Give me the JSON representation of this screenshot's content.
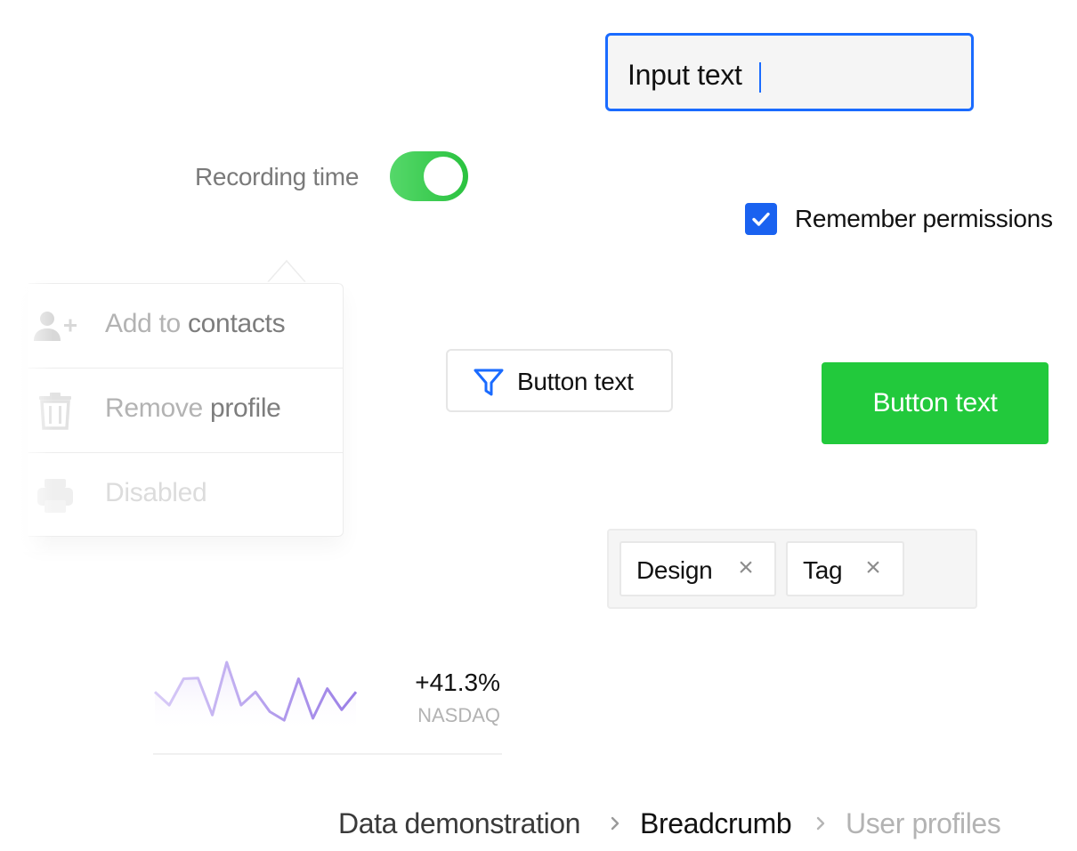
{
  "input": {
    "value": "Input text"
  },
  "toggle": {
    "label": "Recording time",
    "on": true
  },
  "checkbox": {
    "label": "Remember permissions",
    "checked": true
  },
  "menu": {
    "items": [
      {
        "icon": "user-plus-icon",
        "label_light": "Add to ",
        "label_dark": "contacts"
      },
      {
        "icon": "trash-icon",
        "label_light": "Remove ",
        "label_dark": "profile"
      },
      {
        "icon": "printer-icon",
        "label_light": "Disabled",
        "label_dark": ""
      }
    ]
  },
  "buttons": {
    "filter_label": "Button text",
    "filter_icon": "filter-icon",
    "primary_label": "Button text"
  },
  "tags": [
    {
      "label": "Design"
    },
    {
      "label": "Tag"
    }
  ],
  "stock": {
    "change": "+41.3%",
    "name": "NASDAQ",
    "series": [
      0.55,
      0.35,
      0.75,
      0.76,
      0.2,
      1.0,
      0.35,
      0.55,
      0.25,
      0.12,
      0.75,
      0.15,
      0.6,
      0.28,
      0.55
    ]
  },
  "breadcrumb": {
    "items": [
      "Data demonstration",
      "Breadcrumb",
      "User profiles"
    ]
  },
  "colors": {
    "accent_blue": "#1a6bff",
    "success_green": "#22c93c",
    "sparkline": "#a58ce6"
  }
}
